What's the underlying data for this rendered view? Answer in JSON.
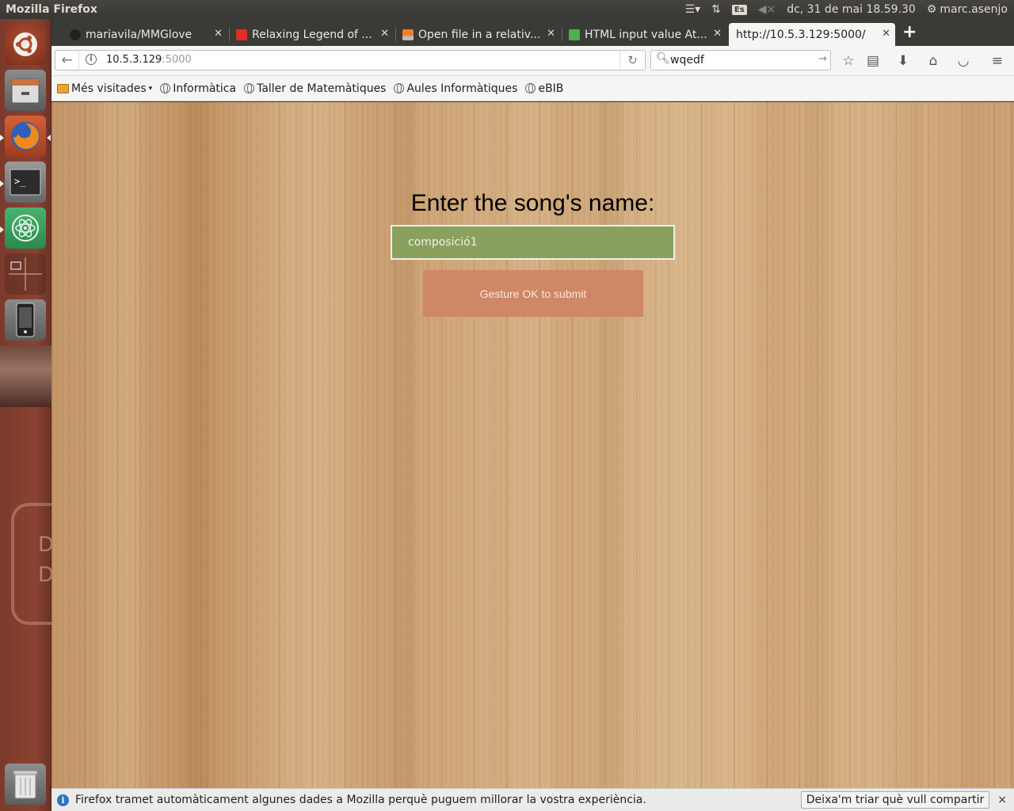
{
  "system": {
    "app_name": "Mozilla Firefox",
    "keyboard_layout": "Es",
    "clock": "dc, 31 de mai 18.59.30",
    "user": "marc.asenjo"
  },
  "launcher": {
    "ghost_text": [
      "D",
      "D"
    ]
  },
  "tabs": [
    {
      "label": "mariavila/MMGlove",
      "favicon": "github-icon"
    },
    {
      "label": "Relaxing Legend of ...",
      "favicon": "youtube-icon"
    },
    {
      "label": "Open file in a relativ...",
      "favicon": "stackoverflow-icon"
    },
    {
      "label": "HTML input value At...",
      "favicon": "w3schools-icon"
    },
    {
      "label": "http://10.5.3.129:5000/",
      "favicon": "",
      "active": true
    }
  ],
  "navbar": {
    "url_host": "10.5.3.129",
    "url_port": ":5000",
    "search_value": "wqedf"
  },
  "bookmarks": {
    "most_visited": "Més visitades",
    "items": [
      "Informàtica",
      "Taller de Matemàtiques",
      "Aules Informàtiques",
      "eBIB"
    ]
  },
  "page": {
    "heading": "Enter the song's name:",
    "input_value": "composició1",
    "submit_label": "Gesture OK to submit",
    "colors": {
      "input_bg": "#8aa15e",
      "button_bg": "#cf8766"
    }
  },
  "notification": {
    "text": "Firefox tramet automàticament algunes dades a Mozilla perquè puguem millorar la vostra experiència.",
    "button": "Deixa'm triar què vull compartir",
    "close": "×"
  }
}
